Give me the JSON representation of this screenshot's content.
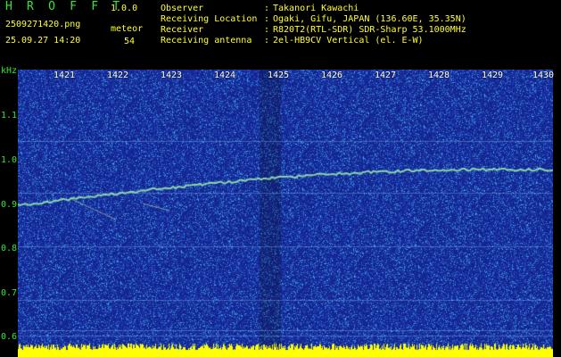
{
  "header": {
    "app_title": "H R O F F T",
    "app_version": "1.0.0",
    "filename": "2509271420.png",
    "datetime": "25.09.27 14:20",
    "meteor_label": "meteor",
    "meteor_count": "54",
    "info": [
      {
        "key": "Observer",
        "value": "Takanori Kawachi"
      },
      {
        "key": "Receiving Location",
        "value": "Ogaki, Gifu, JAPAN (136.60E, 35.35N)"
      },
      {
        "key": "Receiver",
        "value": "R820T2(RTL-SDR) SDR-Sharp 53.1000MHz"
      },
      {
        "key": "Receiving antenna",
        "value": "2el-HB9CV Vertical (el. E-W)"
      }
    ]
  },
  "axis": {
    "unit": "kHz",
    "y_ticks": [
      "1.1",
      "1.0",
      "0.9",
      "0.8",
      "0.7",
      "0.6"
    ],
    "x_ticks": [
      "1421",
      "1422",
      "1423",
      "1424",
      "1425",
      "1426",
      "1427",
      "1428",
      "1429",
      "1430"
    ]
  },
  "colors": {
    "background": "#1a2a9a",
    "signal": "#e8f070",
    "noise_bar": "#ffff00",
    "text_green": "#33e633",
    "text_yellow": "#ffff33"
  }
}
